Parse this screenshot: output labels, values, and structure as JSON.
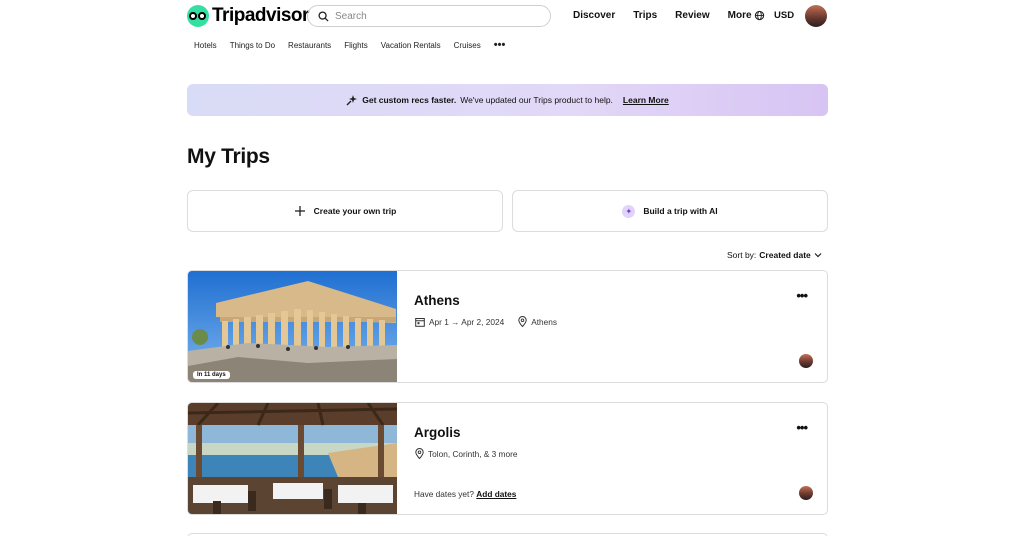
{
  "header": {
    "brand": "Tripadvisor",
    "search_placeholder": "Search",
    "nav": [
      "Discover",
      "Trips",
      "Review",
      "More"
    ],
    "currency": "USD"
  },
  "subnav": [
    "Hotels",
    "Things to Do",
    "Restaurants",
    "Flights",
    "Vacation Rentals",
    "Cruises"
  ],
  "banner": {
    "bold_text": "Get custom recs faster.",
    "text": "We've updated our Trips product to help.",
    "link": "Learn More"
  },
  "page_title": "My Trips",
  "actions": {
    "create": "Create your own trip",
    "ai": "Build a trip with AI"
  },
  "sort": {
    "label": "Sort by:",
    "value": "Created date"
  },
  "trips": [
    {
      "name": "Athens",
      "dates": "Apr 1 → Apr 2, 2024",
      "location": "Athens",
      "badge": "In 11 days"
    },
    {
      "name": "Argolis",
      "location": "Tolon, Corinth, & 3 more",
      "dates_prompt": "Have dates yet?",
      "add_dates": "Add dates"
    }
  ],
  "colors": {
    "brand_green": "#34e0a1",
    "banner_start": "#d9dcf6",
    "banner_end": "#d7c4f3"
  }
}
